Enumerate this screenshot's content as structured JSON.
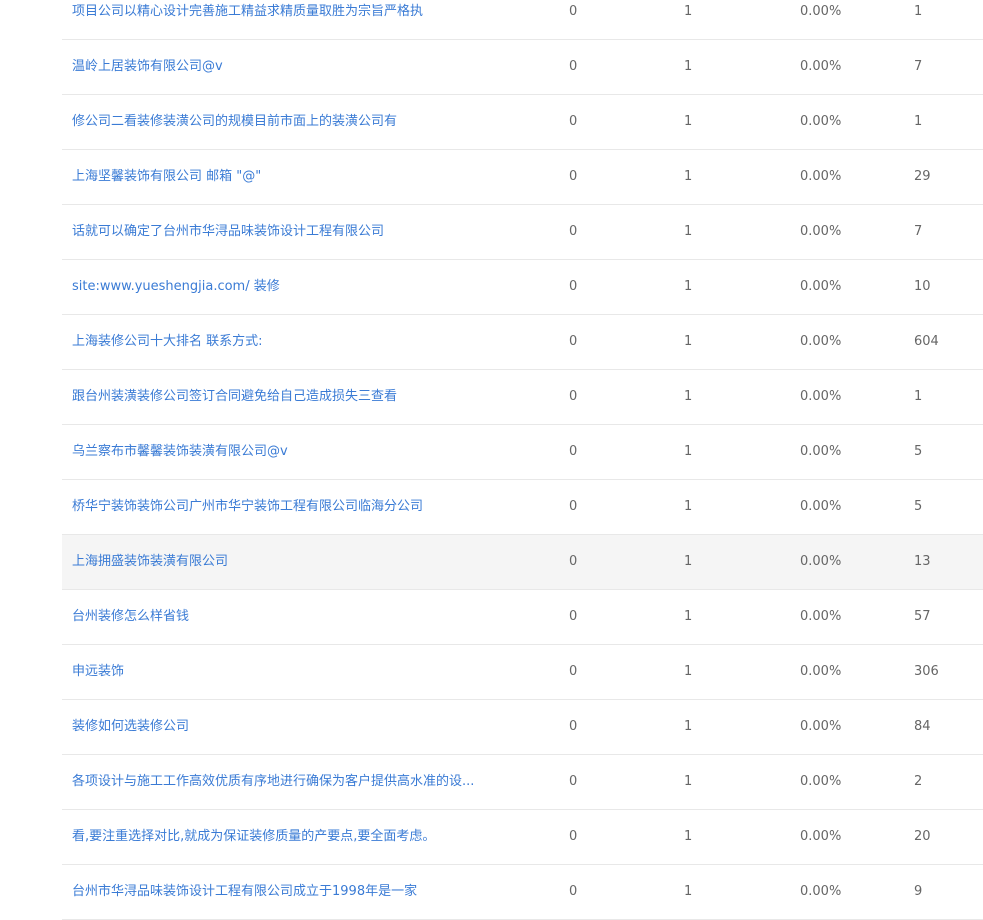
{
  "rows": [
    {
      "keyword": "项目公司以精心设计完善施工精益求精质量取胜为宗旨严格执",
      "a": "0",
      "b": "1",
      "rate": "0.00%",
      "count": "1"
    },
    {
      "keyword": "温岭上居装饰有限公司@v",
      "a": "0",
      "b": "1",
      "rate": "0.00%",
      "count": "7"
    },
    {
      "keyword": "修公司二看装修装潢公司的规模目前市面上的装潢公司有",
      "a": "0",
      "b": "1",
      "rate": "0.00%",
      "count": "1"
    },
    {
      "keyword": "上海坚馨装饰有限公司 邮箱 \"@\"",
      "a": "0",
      "b": "1",
      "rate": "0.00%",
      "count": "29"
    },
    {
      "keyword": "话就可以确定了台州市华浔品味装饰设计工程有限公司",
      "a": "0",
      "b": "1",
      "rate": "0.00%",
      "count": "7"
    },
    {
      "keyword": "site:www.yueshengjia.com/ 装修",
      "a": "0",
      "b": "1",
      "rate": "0.00%",
      "count": "10"
    },
    {
      "keyword": "上海装修公司十大排名 联系方式:",
      "a": "0",
      "b": "1",
      "rate": "0.00%",
      "count": "604"
    },
    {
      "keyword": "跟台州装潢装修公司签订合同避免给自己造成损失三查看",
      "a": "0",
      "b": "1",
      "rate": "0.00%",
      "count": "1"
    },
    {
      "keyword": "乌兰察布市馨馨装饰装潢有限公司@v",
      "a": "0",
      "b": "1",
      "rate": "0.00%",
      "count": "5"
    },
    {
      "keyword": "桥华宁装饰装饰公司广州市华宁装饰工程有限公司临海分公司",
      "a": "0",
      "b": "1",
      "rate": "0.00%",
      "count": "5"
    },
    {
      "keyword": "上海拥盛装饰装潢有限公司",
      "a": "0",
      "b": "1",
      "rate": "0.00%",
      "count": "13"
    },
    {
      "keyword": "台州装修怎么样省钱",
      "a": "0",
      "b": "1",
      "rate": "0.00%",
      "count": "57"
    },
    {
      "keyword": "申远装饰",
      "a": "0",
      "b": "1",
      "rate": "0.00%",
      "count": "306"
    },
    {
      "keyword": "装修如何选装修公司",
      "a": "0",
      "b": "1",
      "rate": "0.00%",
      "count": "84"
    },
    {
      "keyword": "各项设计与施工工作高效优质有序地进行确保为客户提供高水准的设...",
      "a": "0",
      "b": "1",
      "rate": "0.00%",
      "count": "2"
    },
    {
      "keyword": "看,要注重选择对比,就成为保证装修质量的产要点,要全面考虑。",
      "a": "0",
      "b": "1",
      "rate": "0.00%",
      "count": "20"
    },
    {
      "keyword": "台州市华浔品味装饰设计工程有限公司成立于1998年是一家",
      "a": "0",
      "b": "1",
      "rate": "0.00%",
      "count": "9"
    }
  ],
  "colors": {
    "link": "#3a7bd5",
    "text": "#666666",
    "divider": "#e8e8e8",
    "highlight_row": "#f5f5f5"
  },
  "highlighted_row_index": 10
}
